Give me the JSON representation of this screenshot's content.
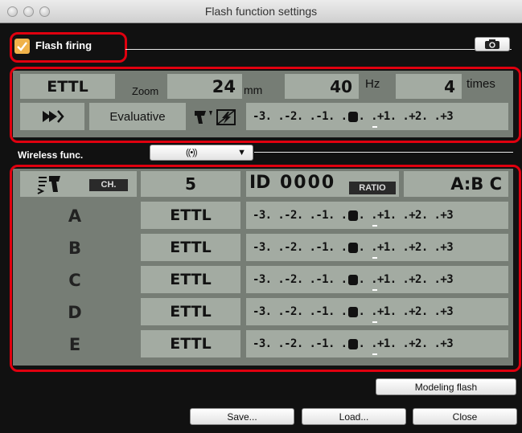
{
  "window": {
    "title": "Flash function settings"
  },
  "flash_firing": {
    "label": "Flash firing",
    "checked": true
  },
  "camera_icon": "camera-rotate-icon",
  "basic": {
    "mode": "ETTL",
    "zoom_label": "Zoom",
    "zoom_value": "24",
    "zoom_unit": "mm",
    "freq_value": "40",
    "freq_unit": "Hz",
    "times_value": "4",
    "times_unit": "times",
    "sync_icon": "high-speed-sync-icon",
    "metering": "Evaluative",
    "fec_icon": "flash-exposure-compensation-icon",
    "scale": {
      "m3": "-3",
      "m2": "-2",
      "m1": "-1",
      "zero": "0",
      "p1": "+1",
      "p2": "+2",
      "p3": "+3"
    }
  },
  "wireless": {
    "label": "Wireless func.",
    "select_icon": "wireless-radio-icon",
    "select_arrow": "▼",
    "master_icon": "master-flash-icon",
    "channel_label": "CH.",
    "channel_value": "5",
    "id_label": "ID",
    "id_value": "0000",
    "ratio_label": "RATIO",
    "ratio_value": "A:B C",
    "groups": [
      {
        "letter": "A",
        "mode": "ETTL"
      },
      {
        "letter": "B",
        "mode": "ETTL"
      },
      {
        "letter": "C",
        "mode": "ETTL"
      },
      {
        "letter": "D",
        "mode": "ETTL"
      },
      {
        "letter": "E",
        "mode": "ETTL"
      }
    ]
  },
  "buttons": {
    "modeling": "Modeling flash",
    "save": "Save...",
    "load": "Load...",
    "close": "Close"
  },
  "colors": {
    "highlight": "#e0000f",
    "lcd": "#a3aba2",
    "panel": "#767d75",
    "checkbox": "#f0b24a"
  }
}
